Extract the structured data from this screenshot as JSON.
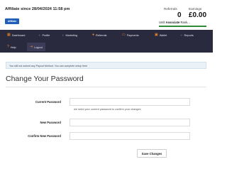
{
  "header": {
    "affiliate_since": "Affiliate since 28/04/2024 11:58 pm",
    "badge": "Affiliate",
    "referrals_label": "Referrals",
    "referrals_value": "0",
    "earnings_label": "Earnings",
    "earnings_value": "£0.00",
    "rank_prefix": "Until",
    "rank_name": "Associate",
    "rank_suffix": "Rank...",
    "rank_color": "#2e8b3a"
  },
  "nav": {
    "background": "#2a2a3f",
    "icon_color": "#f08a24",
    "items": [
      {
        "label": "Dashboard",
        "icon": "dashboard-icon"
      },
      {
        "label": "Profile",
        "icon": "chevron-right-icon"
      },
      {
        "label": "Marketing",
        "icon": "chevron-right-icon"
      },
      {
        "label": "Referrals",
        "icon": "users-icon"
      },
      {
        "label": "Payments",
        "icon": "card-icon"
      },
      {
        "label": "Wallet",
        "icon": "wallet-icon"
      },
      {
        "label": "Reports",
        "icon": "chevron-right-icon"
      },
      {
        "label": "Help",
        "icon": "help-icon"
      },
      {
        "label": "Logout",
        "icon": "logout-icon"
      }
    ]
  },
  "notice": "You still not submit any Payout Method. You can complete setup here",
  "page_title": "Change Your Password",
  "form": {
    "current_label": "Current Password",
    "current_hint": "we need your current password to confirm your changes",
    "new_label": "New Password",
    "confirm_label": "Confirm New Password",
    "save_label": "Save Changes"
  }
}
